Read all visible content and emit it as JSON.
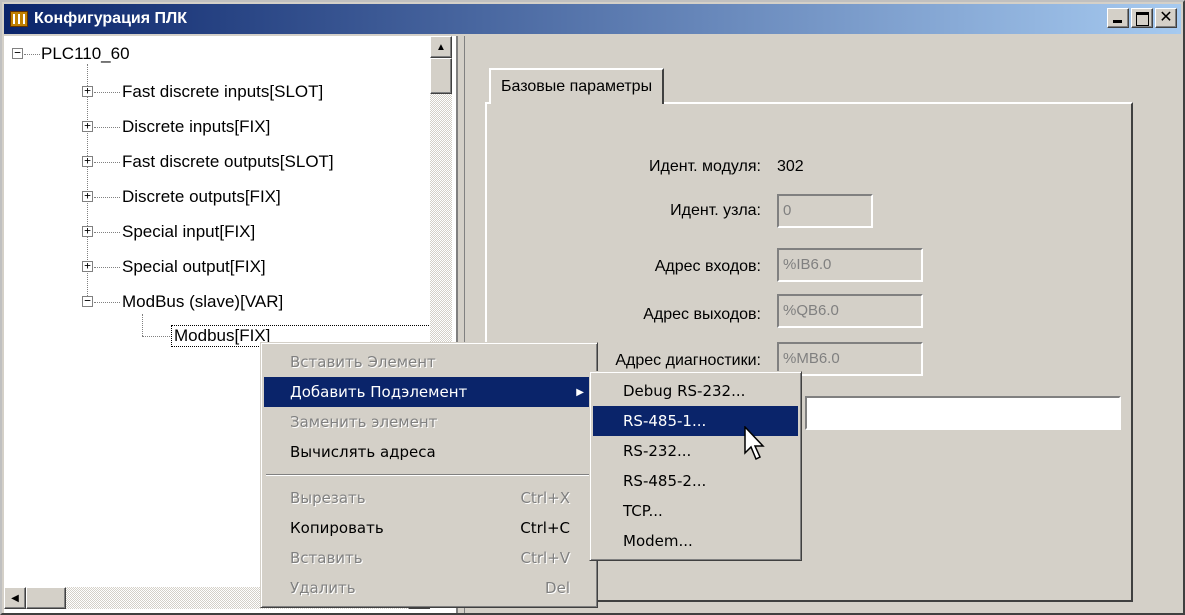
{
  "window": {
    "title": "Конфигурация ПЛК"
  },
  "tree": {
    "root": "PLC110_60",
    "children": [
      {
        "label": "Fast discrete inputs[SLOT]",
        "expander": "+"
      },
      {
        "label": "Discrete inputs[FIX]",
        "expander": "+"
      },
      {
        "label": "Fast discrete outputs[SLOT]",
        "expander": "+"
      },
      {
        "label": "Discrete outputs[FIX]",
        "expander": "+"
      },
      {
        "label": "Special input[FIX]",
        "expander": "+"
      },
      {
        "label": "Special output[FIX]",
        "expander": "+"
      },
      {
        "label": "ModBus (slave)[VAR]",
        "expander": "−"
      }
    ],
    "grandchild": "Modbus[FIX]"
  },
  "panel": {
    "tab": "Базовые параметры",
    "module_id_label": "Идент. модуля:",
    "module_id_value": "302",
    "node_id_label": "Идент. узла:",
    "node_id_value": "0",
    "inputs_label": "Адрес входов:",
    "inputs_value": "%IB6.0",
    "outputs_label": "Адрес выходов:",
    "outputs_value": "%QB6.0",
    "diag_label": "Адрес диагностики:",
    "diag_value": "%MB6.0"
  },
  "context_menu": {
    "items": [
      {
        "label": "Вставить Элемент",
        "disabled": true
      },
      {
        "label": "Добавить Подэлемент",
        "selected": true,
        "submenu": true
      },
      {
        "label": "Заменить элемент",
        "disabled": true
      },
      {
        "label": "Вычислять адреса"
      },
      {
        "label": "Вырезать",
        "shortcut": "Ctrl+X",
        "disabled": true
      },
      {
        "label": "Копировать",
        "shortcut": "Ctrl+C"
      },
      {
        "label": "Вставить",
        "shortcut": "Ctrl+V",
        "disabled": true
      },
      {
        "label": "Удалить",
        "shortcut": "Del",
        "disabled": true
      }
    ]
  },
  "submenu": {
    "items": [
      {
        "label": "Debug RS-232..."
      },
      {
        "label": "RS-485-1...",
        "selected": true
      },
      {
        "label": "RS-232..."
      },
      {
        "label": "RS-485-2..."
      },
      {
        "label": "TCP..."
      },
      {
        "label": "Modem..."
      }
    ]
  },
  "colors": {
    "selection": "#0a246a",
    "face": "#d4d0c8"
  }
}
